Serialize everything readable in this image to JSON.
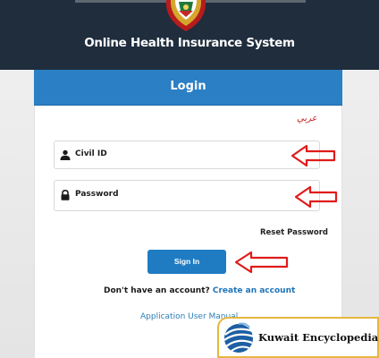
{
  "header": {
    "title": "Online Health Insurance System",
    "emblem_icon": "kuwait-emblem-icon",
    "background_color": "#1f2d3d"
  },
  "login": {
    "title": "Login",
    "language_link": "عربي",
    "civil_id_field": {
      "placeholder": "Civil ID",
      "value": "",
      "icon": "user-icon"
    },
    "password_field": {
      "placeholder": "Password",
      "value": "",
      "icon": "lock-icon"
    },
    "reset_password_label": "Reset Password",
    "signin_label": "Sign In",
    "account_question": "Don't have an account?",
    "create_account_label": "Create an account",
    "manual_label": "Application User Manual"
  },
  "annotations": {
    "arrow_color": "#e01b1b",
    "arrow_icon": "left-arrow-icon"
  },
  "watermark": {
    "text": "Kuwait Encyclopedia",
    "logo_icon": "globe-logo-icon",
    "border_color": "#e5b640"
  },
  "colors": {
    "accent": "#2b7fc5",
    "button": "#1f7cc3",
    "link": "#1f74b8",
    "language_link": "#c62828"
  }
}
